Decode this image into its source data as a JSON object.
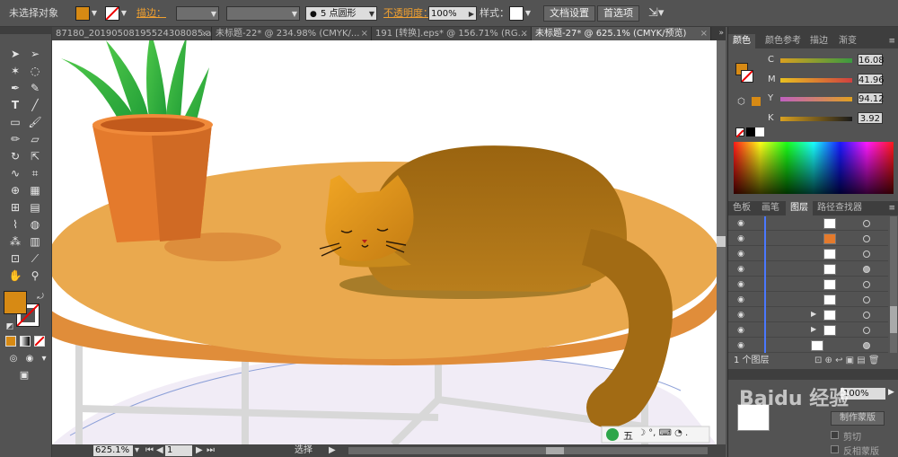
{
  "control_bar": {
    "selection_label": "未选择对象",
    "stroke_label": "描边：",
    "brush_label": "5 点圆形",
    "opacity_label": "不透明度：",
    "opacity_value": "100%",
    "style_label": "样式：",
    "doc_setup_button": "文档设置",
    "prefs_button": "首选项",
    "fill_color": "#d78a14"
  },
  "tabs": [
    {
      "label": "87180_20190508195524308085.ai*"
    },
    {
      "label": "未标题-22* @ 234.98% (CMYK/..."
    },
    {
      "label": "191 [转换].eps* @ 156.71% (RG..."
    },
    {
      "label": "未标题-27* @ 625.1% (CMYK/预览)"
    }
  ],
  "color_panel": {
    "tabs": [
      "颜色",
      "颜色参考",
      "描边",
      "渐变"
    ],
    "channels": [
      {
        "name": "C",
        "value": "16.08"
      },
      {
        "name": "M",
        "value": "41.96"
      },
      {
        "name": "Y",
        "value": "94.12"
      },
      {
        "name": "K",
        "value": "3.92"
      }
    ]
  },
  "layers_panel": {
    "tabs": [
      "色板",
      "画笔",
      "图层",
      "路径查找器"
    ],
    "footer": "1 个图层",
    "rows": 9
  },
  "transparency_panel": {
    "opacity_value": "100%",
    "mask_button": "制作蒙版",
    "clip_label": "剪切",
    "invert_label": "反相蒙版"
  },
  "status_bar": {
    "zoom": "625.1%",
    "page": "1",
    "mode": "选择"
  },
  "ime": {
    "label": "五"
  },
  "watermark": "Baidu 经验"
}
